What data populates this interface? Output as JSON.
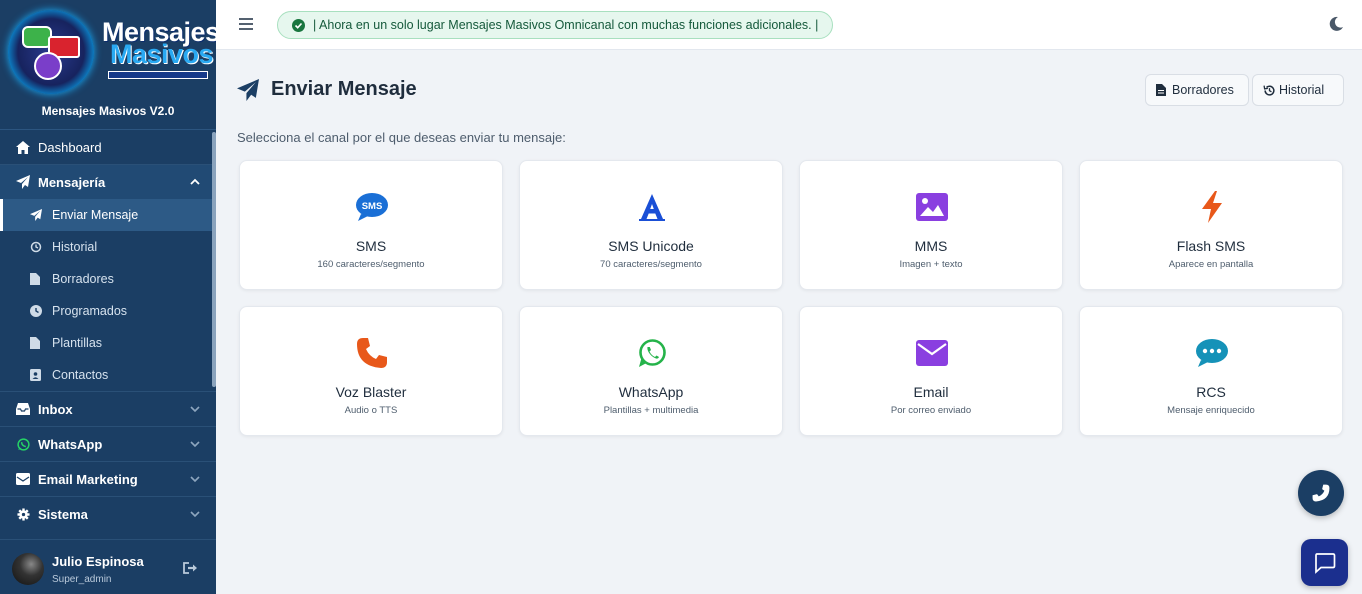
{
  "brand": {
    "logo_line1": "Mensajes",
    "logo_line2": "Masivos",
    "logo_tagline": "COMUNICA · CONECTA · CONVIERTE",
    "title": "Mensajes Masivos V2.0"
  },
  "sidebar": {
    "dashboard": "Dashboard",
    "mensajeria": {
      "label": "Mensajería",
      "items": [
        "Enviar Mensaje",
        "Historial",
        "Borradores",
        "Programados",
        "Plantillas",
        "Contactos"
      ]
    },
    "sections": [
      "Inbox",
      "WhatsApp",
      "Email Marketing",
      "Sistema"
    ]
  },
  "user": {
    "name": "Julio Espinosa",
    "role": "Super_admin"
  },
  "topbar": {
    "notice": "| Ahora en un solo lugar Mensajes Masivos Omnicanal con muchas funciones adicionales. |"
  },
  "main": {
    "title": "Enviar Mensaje",
    "drafts_button": "Borradores",
    "history_button": "Historial",
    "subtitle": "Selecciona el canal por el que deseas enviar tu mensaje:",
    "channels": [
      {
        "name": "SMS",
        "desc": "160 caracteres/segmento",
        "icon": "sms-bubble-icon",
        "color": "#1a6fd6"
      },
      {
        "name": "SMS Unicode",
        "desc": "70 caracteres/segmento",
        "icon": "font-letter-a-icon",
        "color": "#1a4fd6"
      },
      {
        "name": "MMS",
        "desc": "Imagen + texto",
        "icon": "image-icon",
        "color": "#8a3fe0"
      },
      {
        "name": "Flash SMS",
        "desc": "Aparece en pantalla",
        "icon": "bolt-icon",
        "color": "#e8581a"
      },
      {
        "name": "Voz Blaster",
        "desc": "Audio o TTS",
        "icon": "phone-icon",
        "color": "#e8581a"
      },
      {
        "name": "WhatsApp",
        "desc": "Plantillas + multimedia",
        "icon": "whatsapp-icon",
        "color": "#25b34a"
      },
      {
        "name": "Email",
        "desc": "Por correo enviado",
        "icon": "envelope-icon",
        "color": "#8a3fe0"
      },
      {
        "name": "RCS",
        "desc": "Mensaje enriquecido",
        "icon": "chat-dots-icon",
        "color": "#1592b8"
      }
    ]
  }
}
